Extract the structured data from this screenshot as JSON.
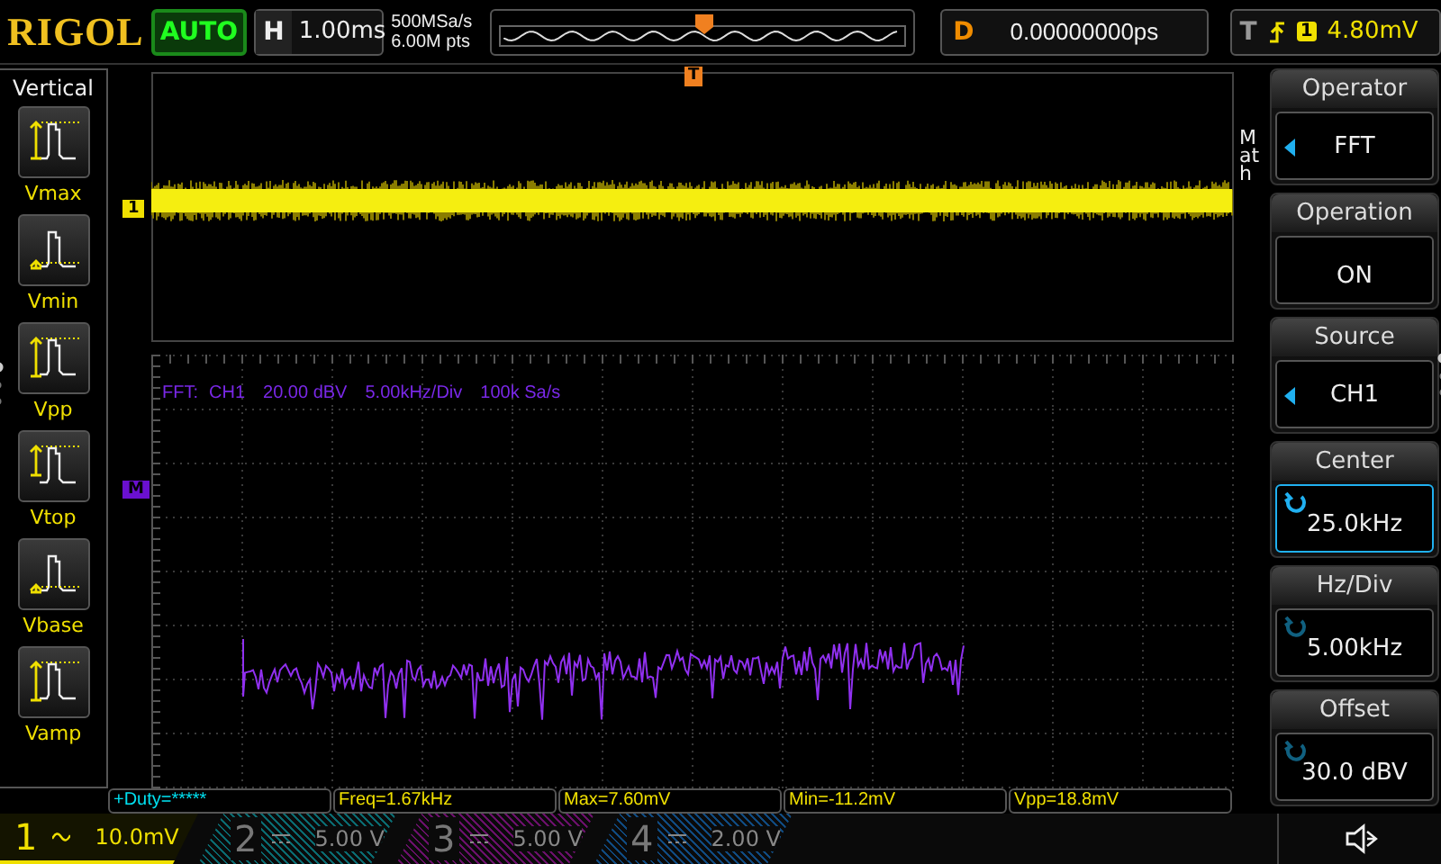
{
  "header": {
    "logo": "RIGOL",
    "mode": "AUTO",
    "timebase_label": "H",
    "timebase": "1.00ms",
    "sample_rate": "500MSa/s",
    "memory_depth": "6.00M pts",
    "delay_label": "D",
    "delay": "0.00000000ps",
    "trigger_label": "T",
    "trigger_source": "1",
    "trigger_level": "4.80mV"
  },
  "left_menu": {
    "title": "Vertical",
    "items": [
      {
        "label": "Vmax",
        "kind": "vmax"
      },
      {
        "label": "Vmin",
        "kind": "vmin"
      },
      {
        "label": "Vpp",
        "kind": "vpp"
      },
      {
        "label": "Vtop",
        "kind": "vtop"
      },
      {
        "label": "Vbase",
        "kind": "vbase"
      },
      {
        "label": "Vamp",
        "kind": "vamp"
      }
    ]
  },
  "waveform": {
    "channel_marker": "1",
    "trigger_marker": "T"
  },
  "fft": {
    "marker": "M",
    "label": "FFT:",
    "source": "CH1",
    "scale": "20.00 dBV",
    "span": "5.00kHz/Div",
    "rate": "100k Sa/s"
  },
  "right_menu": {
    "tab": "Math",
    "items": [
      {
        "title": "Operator",
        "value": "FFT",
        "kind": "list",
        "selected": false
      },
      {
        "title": "Operation",
        "value": "ON",
        "kind": "plain",
        "selected": false
      },
      {
        "title": "Source",
        "value": "CH1",
        "kind": "list",
        "selected": false
      },
      {
        "title": "Center",
        "value": "25.0kHz",
        "kind": "knob",
        "selected": true
      },
      {
        "title": "Hz/Div",
        "value": "5.00kHz",
        "kind": "knob",
        "selected": false
      },
      {
        "title": "Offset",
        "value": "30.0 dBV",
        "kind": "knob",
        "selected": false
      }
    ]
  },
  "measurements": [
    {
      "text": "+Duty=*****",
      "color": "#00e0f0"
    },
    {
      "text": "Freq=1.67kHz",
      "color": "#f0e000"
    },
    {
      "text": "Max=7.60mV",
      "color": "#f0e000"
    },
    {
      "text": "Min=-11.2mV",
      "color": "#f0e000"
    },
    {
      "text": "Vpp=18.8mV",
      "color": "#f0e000"
    }
  ],
  "channels": [
    {
      "number": "1",
      "dc_coupled": false,
      "scale": "10.0mV",
      "on": true,
      "color": "#f0e000"
    },
    {
      "number": "2",
      "dc_coupled": true,
      "scale": "5.00 V",
      "on": false,
      "color": "#0a6a70"
    },
    {
      "number": "3",
      "dc_coupled": true,
      "scale": "5.00 V",
      "on": false,
      "color": "#6a106a"
    },
    {
      "number": "4",
      "dc_coupled": true,
      "scale": "2.00 V",
      "on": false,
      "color": "#104a80"
    }
  ]
}
